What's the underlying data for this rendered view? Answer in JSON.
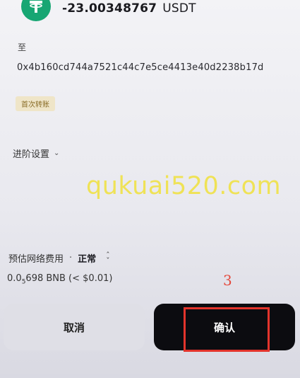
{
  "transaction": {
    "amount": "-23.00348767",
    "unit": "USDT",
    "to_label": "至",
    "address": "0x4b160cd744a7521c44c7e5ce4413e40d2238b17d",
    "badge": "首次转账"
  },
  "advanced_settings": {
    "label": "进阶设置",
    "chevron": "chevron-down-icon"
  },
  "watermark": "qukuai520.com",
  "fee": {
    "label": "预估网络费用",
    "separator": "·",
    "speed": "正常",
    "selector_icon": "up-down-chevron-icon",
    "value_prefix": "0.0",
    "value_sub": "5",
    "value_rest": "698 BNB (< $0.01)"
  },
  "annotation": {
    "step_number": "3",
    "highlight_color": "#e3342c"
  },
  "actions": {
    "cancel_label": "取消",
    "confirm_label": "确认"
  },
  "colors": {
    "token_green": "#17a673",
    "confirm_bg": "#0c0c10",
    "cancel_bg": "#dfdfe6",
    "badge_bg": "#efe5c8",
    "watermark": "#f0e24a"
  }
}
